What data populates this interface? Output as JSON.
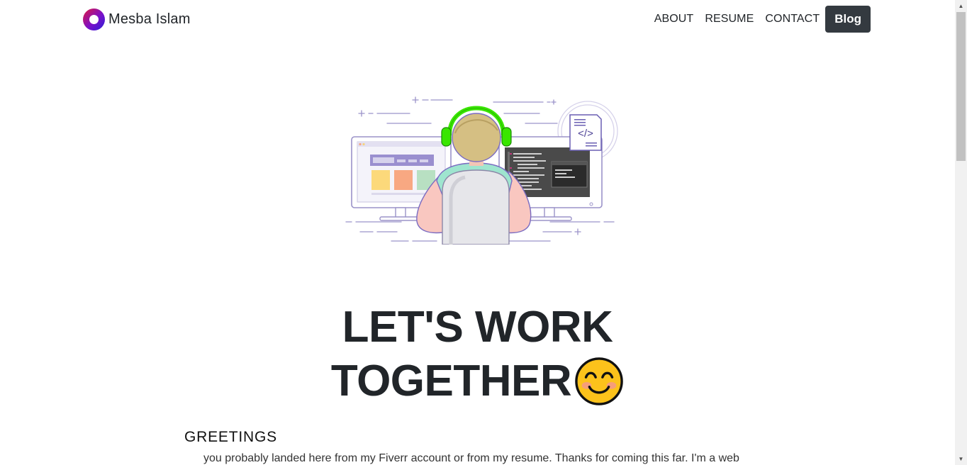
{
  "header": {
    "brand_name": "Mesba Islam",
    "nav": {
      "about": "ABOUT",
      "resume": "RESUME",
      "contact": "CONTACT",
      "blog": "Blog"
    }
  },
  "hero": {
    "illustration_icon": "developer-at-desk-illustration",
    "code_icon_text": "</>",
    "title_line1": "LET'S WORK",
    "title_line2": "TOGETHER",
    "emoji_icon": "smiling-face-icon"
  },
  "greetings": {
    "heading": "GREETINGS",
    "text": "you probably landed here from my Fiverr account or from my resume. Thanks for coming this far. I'm a web"
  },
  "colors": {
    "blog_button_bg": "#343a40",
    "text": "#212529",
    "headphone_green": "#39e600",
    "brand_gradient_start": "#e0193e",
    "brand_gradient_end": "#2a1fd6"
  }
}
